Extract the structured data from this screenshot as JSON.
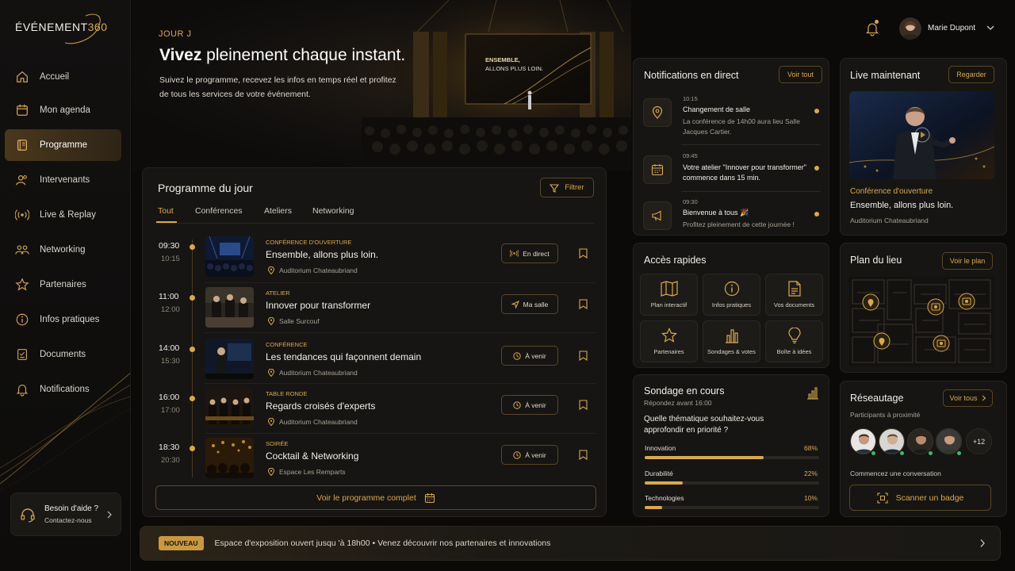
{
  "app": {
    "logo_text": "ÉVÉNEMENT",
    "logo_num": "360"
  },
  "sidebar": {
    "items": [
      {
        "label": "Accueil",
        "icon": "home-icon"
      },
      {
        "label": "Mon agenda",
        "icon": "calendar-icon"
      },
      {
        "label": "Programme",
        "icon": "book-icon",
        "active": true
      },
      {
        "label": "Intervenants",
        "icon": "people-icon"
      },
      {
        "label": "Live & Replay",
        "icon": "broadcast-icon"
      },
      {
        "label": "Networking",
        "icon": "group-icon"
      },
      {
        "label": "Partenaires",
        "icon": "star-icon"
      },
      {
        "label": "Infos pratiques",
        "icon": "info-icon"
      },
      {
        "label": "Documents",
        "icon": "document-icon"
      },
      {
        "label": "Notifications",
        "icon": "bell-icon"
      }
    ],
    "help": {
      "title": "Besoin d'aide ?",
      "subtitle": "Contactez-nous"
    }
  },
  "header": {
    "user_name": "Marie Dupont"
  },
  "hero": {
    "day": "JOUR J",
    "title_bold": "Vivez",
    "title_rest": " pleinement chaque instant.",
    "description": "Suivez le programme, recevez les infos en temps réel et profitez de tous les services de votre événement.",
    "screen_text_1": "ENSEMBLE,",
    "screen_text_2": "ALLONS PLUS LOIN."
  },
  "programme": {
    "title": "Programme du jour",
    "filter_label": "Filtrer",
    "tabs": [
      "Tout",
      "Conférences",
      "Ateliers",
      "Networking"
    ],
    "sessions": [
      {
        "start": "09:30",
        "end": "10:15",
        "category": "Conférence d'ouverture",
        "name": "Ensemble, allons plus loin.",
        "location": "Auditorium Chateaubriand",
        "action": "En direct"
      },
      {
        "start": "11:00",
        "end": "12:00",
        "category": "Atelier",
        "name": "Innover pour transformer",
        "location": "Salle Surcouf",
        "action": "Ma salle"
      },
      {
        "start": "14:00",
        "end": "15:30",
        "category": "Conférence",
        "name": "Les tendances qui façonnent demain",
        "location": "Auditorium Chateaubriand",
        "action": "À venir"
      },
      {
        "start": "16:00",
        "end": "17:00",
        "category": "Table ronde",
        "name": "Regards croisés d'experts",
        "location": "Auditorium Chateaubriand",
        "action": "À venir"
      },
      {
        "start": "18:30",
        "end": "20:30",
        "category": "Soirée",
        "name": "Cocktail & Networking",
        "location": "Espace Les Remparts",
        "action": "À venir"
      }
    ],
    "full_button": "Voir le programme complet"
  },
  "notifications": {
    "title": "Notifications en direct",
    "see_all": "Voir tout",
    "items": [
      {
        "time": "10:15",
        "title": "Changement de salle",
        "text": "La conférence de 14h00 aura lieu Salle Jacques Cartier.",
        "icon": "location-pin-icon"
      },
      {
        "time": "09:45",
        "title": "Votre atelier \"Innover pour transformer\" commence dans 15 min.",
        "text": "",
        "icon": "calendar-icon"
      },
      {
        "time": "09:30",
        "title": "Bienvenue à tous 🎉",
        "text": "Profitez pleinement de cette journée !",
        "icon": "megaphone-icon"
      }
    ]
  },
  "quick": {
    "title": "Accès rapides",
    "items": [
      {
        "label": "Plan interactif",
        "icon": "map-icon"
      },
      {
        "label": "Infos pratiques",
        "icon": "info-icon"
      },
      {
        "label": "Vos documents",
        "icon": "document-icon"
      },
      {
        "label": "Partenaires",
        "icon": "star-icon"
      },
      {
        "label": "Sondages & votes",
        "icon": "bar-chart-icon"
      },
      {
        "label": "Boîte à idées",
        "icon": "lightbulb-icon"
      }
    ]
  },
  "survey": {
    "title": "Sondage en cours",
    "subtitle": "Répondez avant 16:00",
    "question": "Quelle thématique souhaitez-vous approfondir en priorité ?",
    "options": [
      {
        "label": "Innovation",
        "pct": "68%",
        "value": 68
      },
      {
        "label": "Durabilité",
        "pct": "22%",
        "value": 22
      },
      {
        "label": "Technologies",
        "pct": "10%",
        "value": 10
      }
    ]
  },
  "live": {
    "title": "Live maintenant",
    "button": "Regarder",
    "category": "Conférence d'ouverture",
    "name": "Ensemble, allons plus loin.",
    "location": "Auditorium Chateaubriand"
  },
  "plan": {
    "title": "Plan du lieu",
    "button": "Voir le plan"
  },
  "reseau": {
    "title": "Réseautage",
    "button": "Voir tous",
    "subtitle": "Participants à proximité",
    "more": "+12",
    "cta_text": "Commencez une conversation",
    "scan_label": "Scanner un badge"
  },
  "banner": {
    "badge": "NOUVEAU",
    "text": "Espace d'exposition ouvert jusqu 'à 18h00 • Venez découvrir nos partenaires et innovations"
  },
  "colors": {
    "accent": "#d9a94f",
    "background": "#0b0a09",
    "panel": "#161513",
    "online": "#3fb86a"
  }
}
